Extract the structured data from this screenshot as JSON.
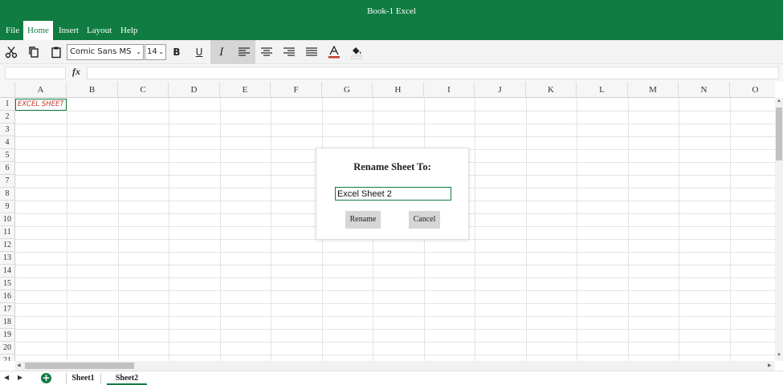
{
  "window": {
    "title": "Book-1 Excel"
  },
  "menu": {
    "items": [
      "File",
      "Home",
      "Insert",
      "Layout",
      "Help"
    ],
    "active": "Home"
  },
  "toolbar": {
    "font_family": "Comic Sans MS",
    "font_size": "14",
    "caret": "⌄",
    "bold": "B",
    "italic": "I",
    "underline": "U",
    "icons": [
      "cut-icon",
      "copy-icon",
      "paste-icon",
      "bold-icon",
      "underline-icon",
      "italic-icon",
      "align-left-icon",
      "align-center-icon",
      "align-right-icon",
      "justify-icon",
      "font-color-icon",
      "fill-color-icon"
    ],
    "font_color_underline": "#c0392b",
    "pressed": [
      "italic",
      "align-left"
    ]
  },
  "formula_bar": {
    "fx": "fx",
    "name_box": "",
    "formula": ""
  },
  "grid": {
    "columns": [
      "A",
      "B",
      "C",
      "D",
      "E",
      "F",
      "G",
      "H",
      "I",
      "J",
      "K",
      "L",
      "M",
      "N",
      "O"
    ],
    "rows": [
      "1",
      "2",
      "3",
      "4",
      "5",
      "6",
      "7",
      "8",
      "9",
      "10",
      "11",
      "12",
      "13",
      "14",
      "15",
      "16",
      "17",
      "18",
      "19",
      "20",
      "21"
    ],
    "cells": {
      "A1": "EXCEL SHEET"
    },
    "selected_cell": "A1",
    "cell_text_color": "#c0392b"
  },
  "dialog": {
    "title": "Rename Sheet To:",
    "input_value": "Excel Sheet 2",
    "rename_label": "Rename",
    "cancel_label": "Cancel"
  },
  "sheets": {
    "tabs": [
      "Sheet1",
      "Sheet2"
    ],
    "active": "Sheet2",
    "add_icon": "+",
    "prev_icon": "◀",
    "next_icon": "▶"
  },
  "theme": {
    "accent": "#107c41"
  }
}
